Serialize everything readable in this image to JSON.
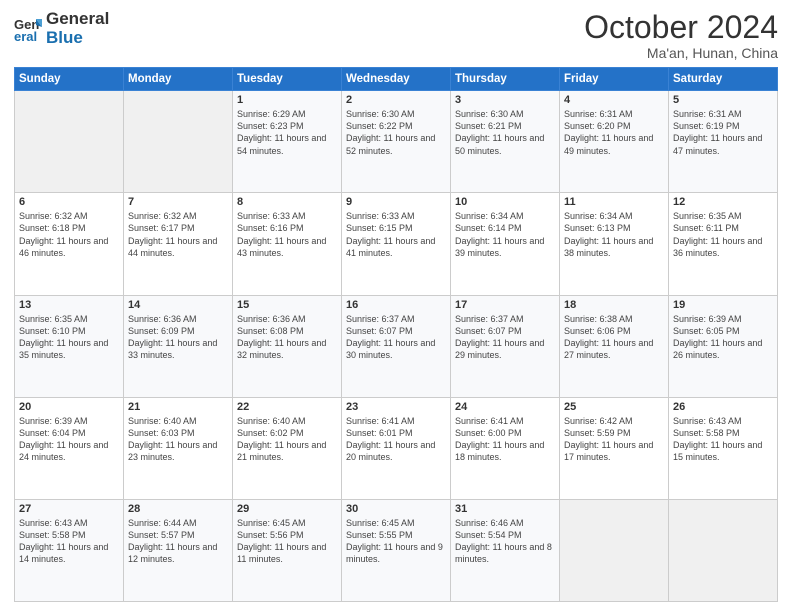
{
  "header": {
    "logo_line1": "General",
    "logo_line2": "Blue",
    "main_title": "October 2024",
    "sub_title": "Ma'an, Hunan, China"
  },
  "weekdays": [
    "Sunday",
    "Monday",
    "Tuesday",
    "Wednesday",
    "Thursday",
    "Friday",
    "Saturday"
  ],
  "weeks": [
    [
      {
        "day": "",
        "info": ""
      },
      {
        "day": "",
        "info": ""
      },
      {
        "day": "1",
        "info": "Sunrise: 6:29 AM\nSunset: 6:23 PM\nDaylight: 11 hours and 54 minutes."
      },
      {
        "day": "2",
        "info": "Sunrise: 6:30 AM\nSunset: 6:22 PM\nDaylight: 11 hours and 52 minutes."
      },
      {
        "day": "3",
        "info": "Sunrise: 6:30 AM\nSunset: 6:21 PM\nDaylight: 11 hours and 50 minutes."
      },
      {
        "day": "4",
        "info": "Sunrise: 6:31 AM\nSunset: 6:20 PM\nDaylight: 11 hours and 49 minutes."
      },
      {
        "day": "5",
        "info": "Sunrise: 6:31 AM\nSunset: 6:19 PM\nDaylight: 11 hours and 47 minutes."
      }
    ],
    [
      {
        "day": "6",
        "info": "Sunrise: 6:32 AM\nSunset: 6:18 PM\nDaylight: 11 hours and 46 minutes."
      },
      {
        "day": "7",
        "info": "Sunrise: 6:32 AM\nSunset: 6:17 PM\nDaylight: 11 hours and 44 minutes."
      },
      {
        "day": "8",
        "info": "Sunrise: 6:33 AM\nSunset: 6:16 PM\nDaylight: 11 hours and 43 minutes."
      },
      {
        "day": "9",
        "info": "Sunrise: 6:33 AM\nSunset: 6:15 PM\nDaylight: 11 hours and 41 minutes."
      },
      {
        "day": "10",
        "info": "Sunrise: 6:34 AM\nSunset: 6:14 PM\nDaylight: 11 hours and 39 minutes."
      },
      {
        "day": "11",
        "info": "Sunrise: 6:34 AM\nSunset: 6:13 PM\nDaylight: 11 hours and 38 minutes."
      },
      {
        "day": "12",
        "info": "Sunrise: 6:35 AM\nSunset: 6:11 PM\nDaylight: 11 hours and 36 minutes."
      }
    ],
    [
      {
        "day": "13",
        "info": "Sunrise: 6:35 AM\nSunset: 6:10 PM\nDaylight: 11 hours and 35 minutes."
      },
      {
        "day": "14",
        "info": "Sunrise: 6:36 AM\nSunset: 6:09 PM\nDaylight: 11 hours and 33 minutes."
      },
      {
        "day": "15",
        "info": "Sunrise: 6:36 AM\nSunset: 6:08 PM\nDaylight: 11 hours and 32 minutes."
      },
      {
        "day": "16",
        "info": "Sunrise: 6:37 AM\nSunset: 6:07 PM\nDaylight: 11 hours and 30 minutes."
      },
      {
        "day": "17",
        "info": "Sunrise: 6:37 AM\nSunset: 6:07 PM\nDaylight: 11 hours and 29 minutes."
      },
      {
        "day": "18",
        "info": "Sunrise: 6:38 AM\nSunset: 6:06 PM\nDaylight: 11 hours and 27 minutes."
      },
      {
        "day": "19",
        "info": "Sunrise: 6:39 AM\nSunset: 6:05 PM\nDaylight: 11 hours and 26 minutes."
      }
    ],
    [
      {
        "day": "20",
        "info": "Sunrise: 6:39 AM\nSunset: 6:04 PM\nDaylight: 11 hours and 24 minutes."
      },
      {
        "day": "21",
        "info": "Sunrise: 6:40 AM\nSunset: 6:03 PM\nDaylight: 11 hours and 23 minutes."
      },
      {
        "day": "22",
        "info": "Sunrise: 6:40 AM\nSunset: 6:02 PM\nDaylight: 11 hours and 21 minutes."
      },
      {
        "day": "23",
        "info": "Sunrise: 6:41 AM\nSunset: 6:01 PM\nDaylight: 11 hours and 20 minutes."
      },
      {
        "day": "24",
        "info": "Sunrise: 6:41 AM\nSunset: 6:00 PM\nDaylight: 11 hours and 18 minutes."
      },
      {
        "day": "25",
        "info": "Sunrise: 6:42 AM\nSunset: 5:59 PM\nDaylight: 11 hours and 17 minutes."
      },
      {
        "day": "26",
        "info": "Sunrise: 6:43 AM\nSunset: 5:58 PM\nDaylight: 11 hours and 15 minutes."
      }
    ],
    [
      {
        "day": "27",
        "info": "Sunrise: 6:43 AM\nSunset: 5:58 PM\nDaylight: 11 hours and 14 minutes."
      },
      {
        "day": "28",
        "info": "Sunrise: 6:44 AM\nSunset: 5:57 PM\nDaylight: 11 hours and 12 minutes."
      },
      {
        "day": "29",
        "info": "Sunrise: 6:45 AM\nSunset: 5:56 PM\nDaylight: 11 hours and 11 minutes."
      },
      {
        "day": "30",
        "info": "Sunrise: 6:45 AM\nSunset: 5:55 PM\nDaylight: 11 hours and 9 minutes."
      },
      {
        "day": "31",
        "info": "Sunrise: 6:46 AM\nSunset: 5:54 PM\nDaylight: 11 hours and 8 minutes."
      },
      {
        "day": "",
        "info": ""
      },
      {
        "day": "",
        "info": ""
      }
    ]
  ]
}
